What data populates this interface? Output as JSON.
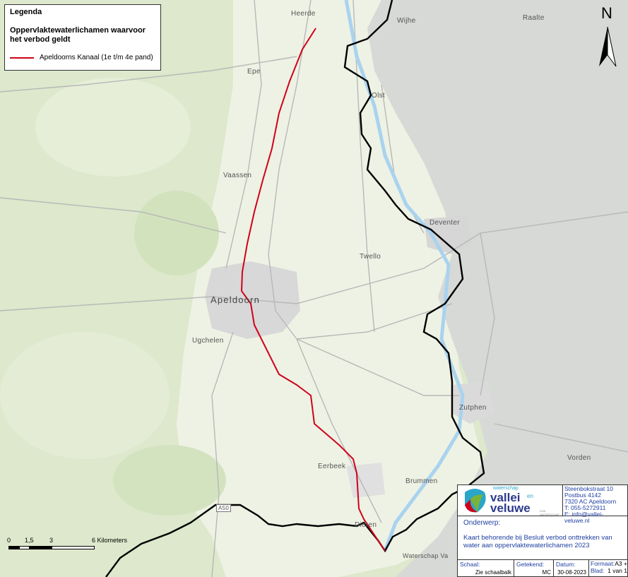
{
  "legend": {
    "title": "Legenda",
    "subtitle": "Oppervlaktewaterlichamen waarvoor het verbod geldt",
    "item_label": "Apeldoorns Kanaal (1e t/m 4e pand)",
    "item_color": "#d0021b"
  },
  "north_arrow": {
    "label": "N",
    "icon": "north-arrow-icon"
  },
  "places": {
    "heerde": "Heerde",
    "wijhe": "Wijhe",
    "raalte": "Raalte",
    "epe": "Epe",
    "olst": "Olst",
    "vaassen": "Vaassen",
    "deventer": "Deventer",
    "twello": "Twello",
    "apeldoorn": "Apeldoorn",
    "ugchelen": "Ugchelen",
    "zutphen": "Zutphen",
    "vorden": "Vorden",
    "eerbeek": "Eerbeek",
    "brummen": "Brummen",
    "dieren": "Dieren",
    "ws_label": "Waterschap Va",
    "road_a50": "A50"
  },
  "scale_bar": {
    "tick_0": "0",
    "tick_1": "1,5",
    "tick_2": "3",
    "tick_3": "6 Kilometers"
  },
  "title_block": {
    "logo_small": "waterschap",
    "logo_main": "vallei",
    "logo_en": "en",
    "logo_sub": "veluwe",
    "logo_tag": "ZIJN WATERSCHAP",
    "address": [
      "Steenbokstraat 10",
      "Postbus 4142",
      "7320 AC Apeldoorn",
      "T: 055-5272911",
      "E: info@vallei-veluwe.nl"
    ],
    "subject_label": "Onderwerp:",
    "subject_text": "Kaart behorende bij Besluit verbod onttrekken van water aan oppervlaktewaterlichamen 2023",
    "schaal_label": "Schaal:",
    "schaal_value": "Zie schaalbalk",
    "getekend_label": "Getekend:",
    "getekend_value": "MC",
    "datum_label": "Datum:",
    "datum_value": "30-08-2023",
    "formaat_label": "Formaat:",
    "formaat_value": "A3 +",
    "blad_label": "Blad:",
    "blad_value": "1 van 1"
  },
  "colors": {
    "canal": "#d0021b",
    "boundary": "#000000",
    "water": "#a9d3ef",
    "forest": "#d8e6c4",
    "agri": "#eef2e6",
    "urban": "#d9d9d9",
    "east_grey": "#d3d6d3",
    "brand_blue": "#1f3fa0"
  }
}
